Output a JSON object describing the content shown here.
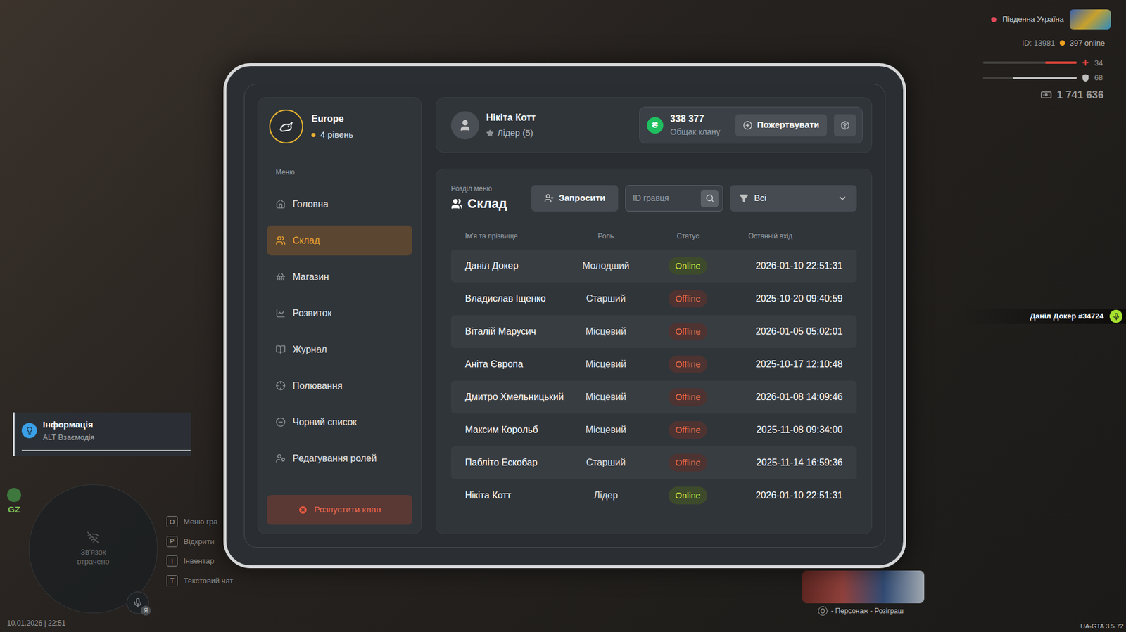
{
  "hud": {
    "server": "Південна Україна",
    "id": "ID: 13981",
    "online": "397 online",
    "health": {
      "reading": "34",
      "level": 0.34
    },
    "armor": {
      "reading": "68",
      "level": 0.68
    },
    "money": "1 741 636"
  },
  "clan": {
    "name": "Europe",
    "level": "4 рівень"
  },
  "sidebar": {
    "label": "Меню",
    "items": [
      {
        "label": "Головна",
        "selected": false
      },
      {
        "label": "Склад",
        "selected": true
      },
      {
        "label": "Магазин",
        "selected": false
      },
      {
        "label": "Розвиток",
        "selected": false
      },
      {
        "label": "Журнал",
        "selected": false
      },
      {
        "label": "Полювання",
        "selected": false
      },
      {
        "label": "Чорний список",
        "selected": false
      },
      {
        "label": "Редагування ролей",
        "selected": false
      }
    ],
    "disband": "Розпустити клан"
  },
  "profile": {
    "name": "Нікіта Котт",
    "role": "Лідер (5)"
  },
  "treasury": {
    "currency_icon": "₴",
    "amount": "338 377",
    "label": "Общак клану",
    "donate": "Пожертвувати"
  },
  "section": {
    "label": "Розділ меню",
    "title": "Склад",
    "invite": "Запросити",
    "search_placeholder": "ID гравця",
    "filter": "Всі"
  },
  "table": {
    "columns": [
      "Ім'я та прізвище",
      "Роль",
      "Статус",
      "Останній вхід"
    ],
    "rows": [
      {
        "name": "Даніл Докер",
        "role": "Молодший",
        "status": "Online",
        "online": true,
        "last_login": "2026-01-10 22:51:31"
      },
      {
        "name": "Владислав Іщенко",
        "role": "Старший",
        "status": "Offline",
        "online": false,
        "last_login": "2025-10-20 09:40:59"
      },
      {
        "name": "Віталій Марусич",
        "role": "Місцевий",
        "status": "Offline",
        "online": false,
        "last_login": "2026-01-05 05:02:01"
      },
      {
        "name": "Аніта Європа",
        "role": "Місцевий",
        "status": "Offline",
        "online": false,
        "last_login": "2025-10-17 12:10:48"
      },
      {
        "name": "Дмитро Хмельницький",
        "role": "Місцевий",
        "status": "Offline",
        "online": false,
        "last_login": "2026-01-08 14:09:46"
      },
      {
        "name": "Максим Корольб",
        "role": "Місцевий",
        "status": "Offline",
        "online": false,
        "last_login": "2025-11-08 09:34:00"
      },
      {
        "name": "Пабліто Ескобар",
        "role": "Старший",
        "status": "Offline",
        "online": false,
        "last_login": "2025-11-14 16:59:36"
      },
      {
        "name": "Нікіта Котт",
        "role": "Лідер",
        "status": "Online",
        "online": true,
        "last_login": "2026-01-10 22:51:31"
      }
    ]
  },
  "info": {
    "title": "Інформація",
    "hint": "ALT Взаємодія"
  },
  "minimap": {
    "zone": "GZ",
    "message": "Зв'язок втрачено",
    "mic_badge": "Я"
  },
  "keys": [
    {
      "key": "O",
      "label": "Меню гра"
    },
    {
      "key": "P",
      "label": "Відкрити"
    },
    {
      "key": "I",
      "label": "Інвентар"
    },
    {
      "key": "T",
      "label": "Текстовий чат"
    }
  ],
  "datetime": "10.01.2026 | 22:51",
  "player_tag": {
    "name": "Даніл Докер #34724",
    "talking": true
  },
  "giveaway": {
    "key": "O",
    "hint": "- Персонаж - Розіграш"
  },
  "version": "UA-GTA 3.5 72"
}
